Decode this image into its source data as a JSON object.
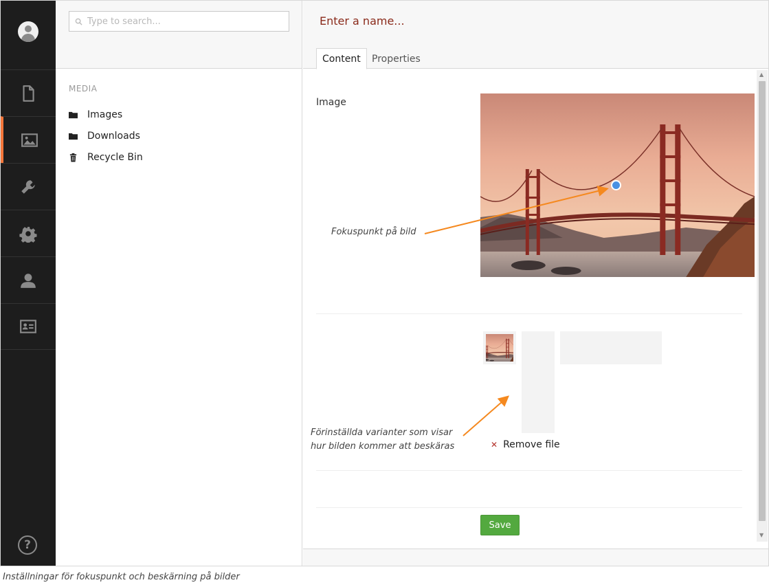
{
  "nav": {
    "items": [
      {
        "icon": "document-icon",
        "label": "Content"
      },
      {
        "icon": "image-icon",
        "label": "Media"
      },
      {
        "icon": "wrench-icon",
        "label": "Developer"
      },
      {
        "icon": "gear-icon",
        "label": "Settings"
      },
      {
        "icon": "user-icon",
        "label": "Users"
      },
      {
        "icon": "id-card-icon",
        "label": "Members"
      }
    ],
    "active_index": 1,
    "accent_color": "#f5773b",
    "help_label": "?"
  },
  "tree": {
    "search_placeholder": "Type to search...",
    "section_title": "MEDIA",
    "items": [
      {
        "label": "Images",
        "icon": "folder-icon"
      },
      {
        "label": "Downloads",
        "icon": "folder-icon"
      },
      {
        "label": "Recycle Bin",
        "icon": "trash-icon"
      }
    ]
  },
  "editor": {
    "name_placeholder": "Enter a name...",
    "tabs": [
      {
        "label": "Content",
        "active": true
      },
      {
        "label": "Properties",
        "active": false
      }
    ],
    "property_label": "Image",
    "remove_file_label": "Remove file",
    "save_label": "Save",
    "save_color": "#53a93f"
  },
  "annotations": {
    "focal_point": "Fokuspunkt på bild",
    "crop_line1": "Förinställda varianter som visar",
    "crop_line2": "hur bilden kommer att beskäras",
    "arrow_color": "#f5891f"
  },
  "caption": "Inställningar för fokuspunkt och beskärning på bilder"
}
